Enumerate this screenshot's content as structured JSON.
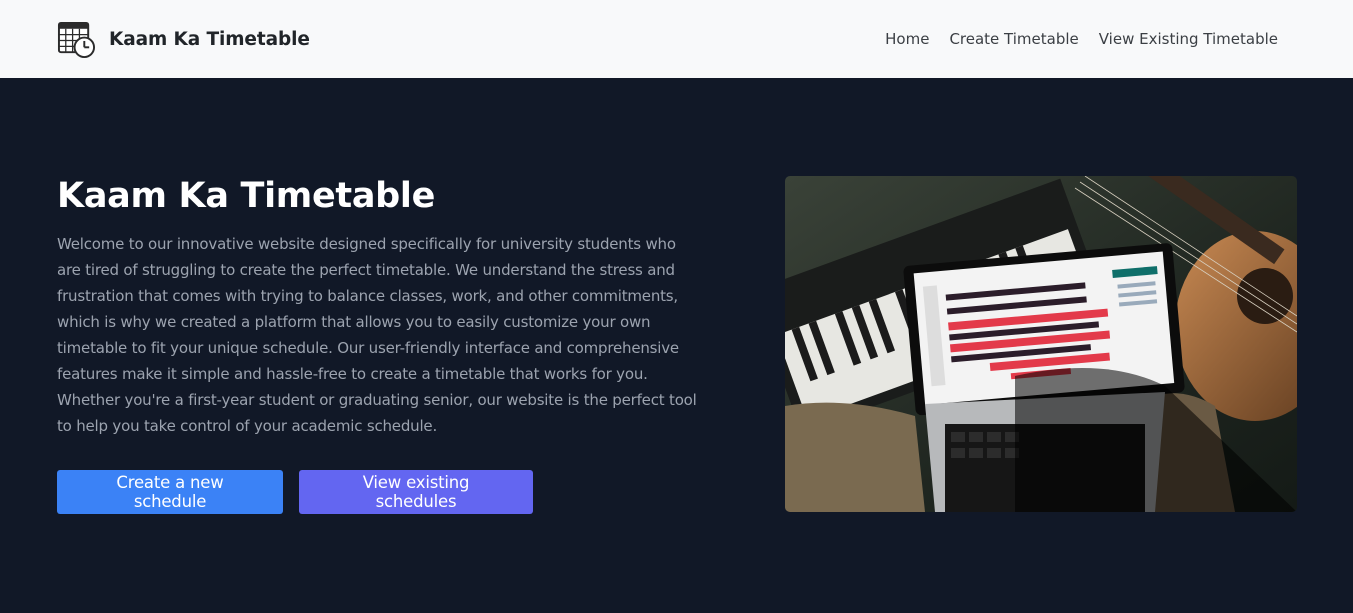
{
  "navbar": {
    "brand": "Kaam Ka Timetable",
    "logo_icon": "calendar-clock-icon",
    "links": [
      {
        "label": "Home"
      },
      {
        "label": "Create Timetable"
      },
      {
        "label": "View Existing Timetable"
      }
    ],
    "background": "#f8f9fa"
  },
  "hero": {
    "title": "Kaam Ka Timetable",
    "description": "Welcome to our innovative website designed specifically for university students who are tired of struggling to create the perfect timetable. We understand the stress and frustration that comes with trying to balance classes, work, and other commitments, which is why we created a platform that allows you to easily customize your own timetable to fit your unique schedule. Our user-friendly interface and comprehensive features make it simple and hassle-free to create a timetable that works for you. Whether you're a first-year student or graduating senior, our website is the perfect tool to help you take control of your academic schedule.",
    "primary_button": "Create a new schedule",
    "secondary_button": "View existing schedules",
    "image_alt": "laptop with timetable on desk with keyboard and guitar",
    "background": "#111827",
    "primary_color": "#3b82f6",
    "secondary_color": "#6366f1"
  }
}
